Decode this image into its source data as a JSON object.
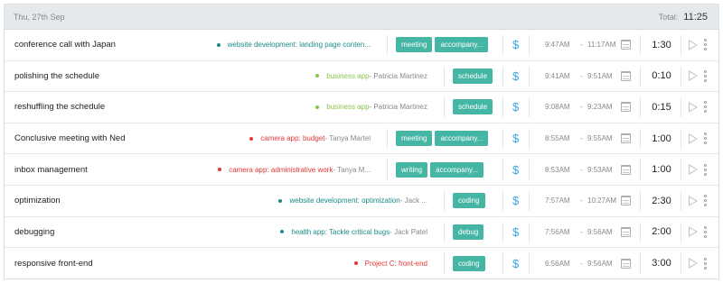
{
  "header": {
    "date": "Thu, 27th Sep",
    "total_label": "Total:",
    "total_value": "11:25"
  },
  "colors": {
    "teal": "#1a8a8a",
    "green": "#8bc34a",
    "red": "#e53935",
    "tag": "#45b5a4",
    "dollar": "#3fa3e0"
  },
  "entries": [
    {
      "description": "conference call with Japan",
      "project": "website development: landing page conten...",
      "client": "",
      "dot_color": "#1a8a8a",
      "tags": [
        "meeting",
        "accompany..."
      ],
      "billable_icon": "dollar-icon",
      "start": "9:47AM",
      "end": "11:17AM",
      "duration": "1:30"
    },
    {
      "description": "polishing the schedule",
      "project": "business app",
      "client": " - Patricia Martinez",
      "dot_color": "#8bc34a",
      "tags": [
        "schedule"
      ],
      "billable_icon": "dollar-icon",
      "start": "9:41AM",
      "end": "9:51AM",
      "duration": "0:10"
    },
    {
      "description": "reshuffling the schedule",
      "project": "business app",
      "client": " - Patricia Martinez",
      "dot_color": "#8bc34a",
      "tags": [
        "schedule"
      ],
      "billable_icon": "dollar-icon",
      "start": "9:08AM",
      "end": "9:23AM",
      "duration": "0:15"
    },
    {
      "description": "Conclusive meeting with Ned",
      "project": "camera app: budget",
      "client": " - Tanya Martel",
      "dot_color": "#e53935",
      "tags": [
        "meeting",
        "accompany..."
      ],
      "billable_icon": "dollar-icon",
      "start": "8:55AM",
      "end": "9:55AM",
      "duration": "1:00"
    },
    {
      "description": "inbox management",
      "project": "camera app: administrative work",
      "client": " - Tanya M...",
      "dot_color": "#e53935",
      "tags": [
        "writing",
        "accompany..."
      ],
      "billable_icon": "dollar-icon",
      "start": "8:53AM",
      "end": "9:53AM",
      "duration": "1:00"
    },
    {
      "description": "optimization",
      "project": "website development: optimization",
      "client": " - Jack ...",
      "dot_color": "#1a8a8a",
      "tags": [
        "coding"
      ],
      "billable_icon": "dollar-icon",
      "start": "7:57AM",
      "end": "10:27AM",
      "duration": "2:30"
    },
    {
      "description": "debugging",
      "project": "health app: Tackle critical bugs",
      "client": " - Jack Patel",
      "dot_color": "#1a8a8a",
      "tags": [
        "debug"
      ],
      "billable_icon": "dollar-icon",
      "start": "7:56AM",
      "end": "9:56AM",
      "duration": "2:00"
    },
    {
      "description": "responsive front-end",
      "project": "Project C: front-end",
      "client": "",
      "dot_color": "#e53935",
      "tags": [
        "coding"
      ],
      "billable_icon": "dollar-icon",
      "start": "6:56AM",
      "end": "9:56AM",
      "duration": "3:00"
    }
  ]
}
